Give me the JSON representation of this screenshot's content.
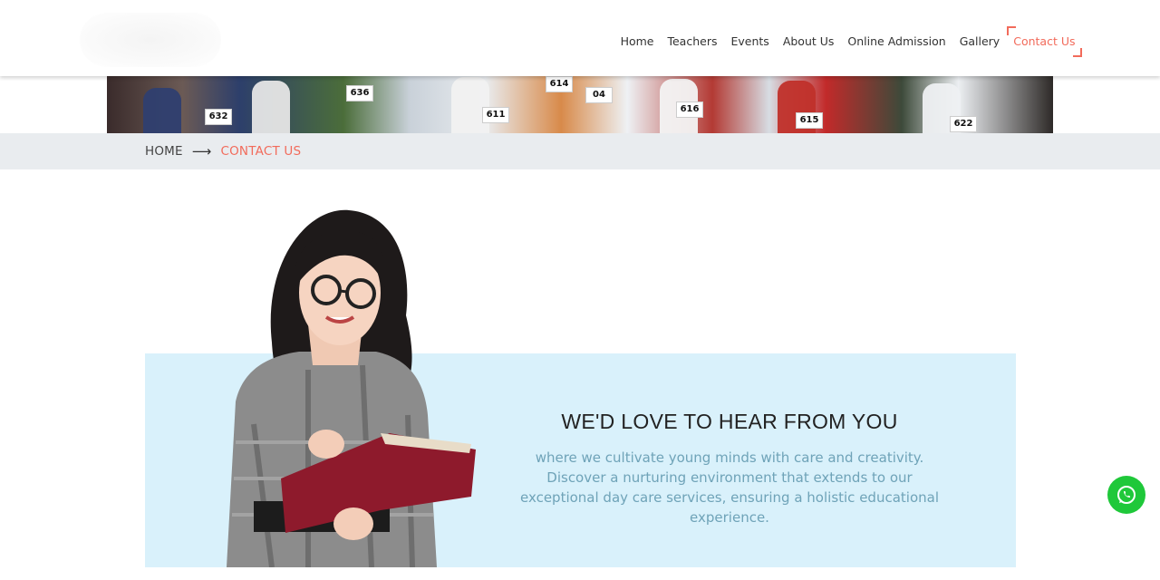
{
  "nav": {
    "items": [
      {
        "label": "Home",
        "active": false
      },
      {
        "label": "Teachers",
        "active": false
      },
      {
        "label": "Events",
        "active": false
      },
      {
        "label": "About Us",
        "active": false
      },
      {
        "label": "Online Admission",
        "active": false
      },
      {
        "label": "Gallery",
        "active": false
      },
      {
        "label": "Contact Us",
        "active": true
      }
    ]
  },
  "banner": {
    "bibs": [
      "632",
      "636",
      "614",
      "611",
      "04",
      "616",
      "615",
      "622"
    ]
  },
  "breadcrumb": {
    "home": "HOME",
    "current": "CONTACT US"
  },
  "contact": {
    "heading": "WE'D LOVE TO HEAR FROM YOU",
    "text": "where we cultivate young minds with care and creativity. Discover a nurturing environment that extends to our exceptional day care services, ensuring a holistic educational experience."
  },
  "colors": {
    "accent": "#f26b5b",
    "panel_bg": "#d9f1fb",
    "body_text": "#6fa3b8",
    "whatsapp": "#1fc83a"
  },
  "icons": {
    "arrow": "right-arrow-icon",
    "whatsapp": "whatsapp-icon"
  }
}
